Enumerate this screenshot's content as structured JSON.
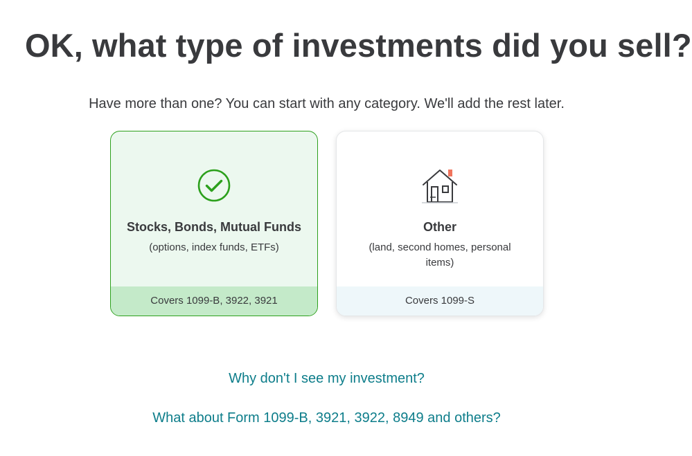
{
  "page": {
    "title": "OK, what type of investments did you sell?",
    "subtitle": "Have more than one? You can start with any category. We'll add the rest later."
  },
  "cards": [
    {
      "id": "stocks",
      "selected": true,
      "icon": "check-circle-icon",
      "title": "Stocks, Bonds, Mutual Funds",
      "description": "(options, index funds, ETFs)",
      "footer": "Covers 1099-B, 3922, 3921"
    },
    {
      "id": "other",
      "selected": false,
      "icon": "house-icon",
      "title": "Other",
      "description": "(land, second homes, personal items)",
      "footer": "Covers 1099-S"
    }
  ],
  "links": {
    "why_not_see": "Why don't I see my investment?",
    "what_about_forms": "What about Form 1099-B, 3921, 3922, 8949 and others?"
  },
  "colors": {
    "text": "#393a3d",
    "link": "#0d7d8a",
    "selected_border": "#2ca01c",
    "selected_bg": "#ecf8ef",
    "selected_footer": "#c4eac9",
    "check": "#2ca01c",
    "chimney": "#f0745d"
  }
}
